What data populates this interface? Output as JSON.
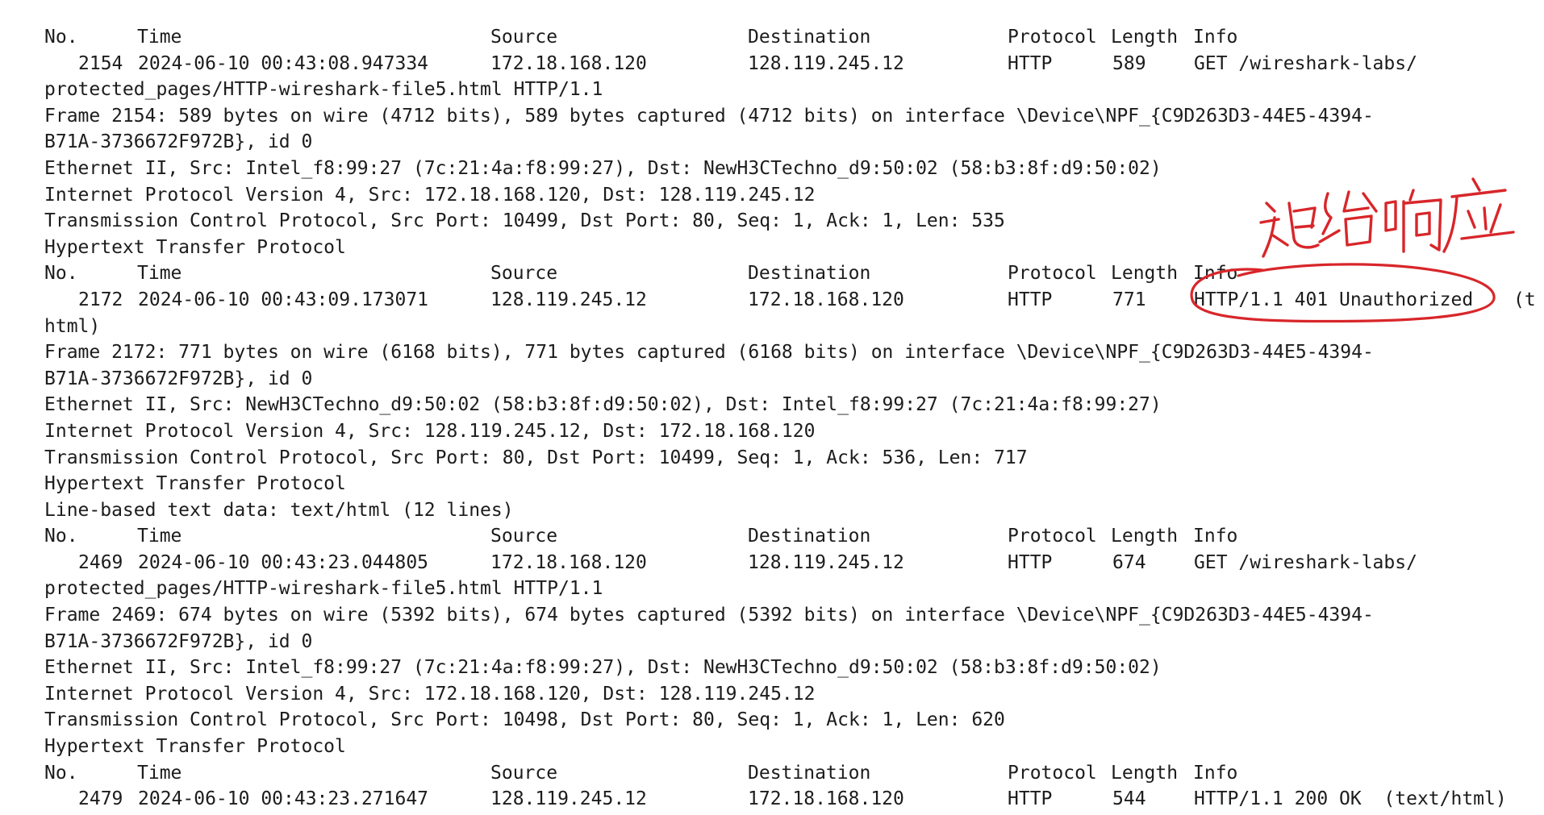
{
  "header": {
    "no": "No.",
    "time": "Time",
    "source": "Source",
    "destination": "Destination",
    "protocol": "Protocol",
    "length": "Length",
    "info": "Info"
  },
  "packets": [
    {
      "summary": {
        "no": "2154",
        "time": "2024-06-10 00:43:08.947334",
        "source": "172.18.168.120",
        "destination": "128.119.245.12",
        "protocol": "HTTP",
        "length": "589",
        "info": "GET /wireshark-labs/",
        "trail": ""
      },
      "details": [
        "protected_pages/HTTP-wireshark-file5.html HTTP/1.1",
        "Frame 2154: 589 bytes on wire (4712 bits), 589 bytes captured (4712 bits) on interface \\Device\\NPF_{C9D263D3-44E5-4394-",
        "B71A-3736672F972B}, id 0",
        "Ethernet II, Src: Intel_f8:99:27 (7c:21:4a:f8:99:27), Dst: NewH3CTechno_d9:50:02 (58:b3:8f:d9:50:02)",
        "Internet Protocol Version 4, Src: 172.18.168.120, Dst: 128.119.245.12",
        "Transmission Control Protocol, Src Port: 10499, Dst Port: 80, Seq: 1, Ack: 1, Len: 535",
        "Hypertext Transfer Protocol"
      ]
    },
    {
      "summary": {
        "no": "2172",
        "time": "2024-06-10 00:43:09.173071",
        "source": "128.119.245.12",
        "destination": "172.18.168.120",
        "protocol": "HTTP",
        "length": "771",
        "info": "HTTP/1.1 401 Unauthorized",
        "trail": "(t"
      },
      "details": [
        "html)",
        "Frame 2172: 771 bytes on wire (6168 bits), 771 bytes captured (6168 bits) on interface \\Device\\NPF_{C9D263D3-44E5-4394-",
        "B71A-3736672F972B}, id 0",
        "Ethernet II, Src: NewH3CTechno_d9:50:02 (58:b3:8f:d9:50:02), Dst: Intel_f8:99:27 (7c:21:4a:f8:99:27)",
        "Internet Protocol Version 4, Src: 128.119.245.12, Dst: 172.18.168.120",
        "Transmission Control Protocol, Src Port: 80, Dst Port: 10499, Seq: 1, Ack: 536, Len: 717",
        "Hypertext Transfer Protocol",
        "Line-based text data: text/html (12 lines)"
      ]
    },
    {
      "summary": {
        "no": "2469",
        "time": "2024-06-10 00:43:23.044805",
        "source": "172.18.168.120",
        "destination": "128.119.245.12",
        "protocol": "HTTP",
        "length": "674",
        "info": "GET /wireshark-labs/",
        "trail": ""
      },
      "details": [
        "protected_pages/HTTP-wireshark-file5.html HTTP/1.1",
        "Frame 2469: 674 bytes on wire (5392 bits), 674 bytes captured (5392 bits) on interface \\Device\\NPF_{C9D263D3-44E5-4394-",
        "B71A-3736672F972B}, id 0",
        "Ethernet II, Src: Intel_f8:99:27 (7c:21:4a:f8:99:27), Dst: NewH3CTechno_d9:50:02 (58:b3:8f:d9:50:02)",
        "Internet Protocol Version 4, Src: 172.18.168.120, Dst: 128.119.245.12",
        "Transmission Control Protocol, Src Port: 10498, Dst Port: 80, Seq: 1, Ack: 1, Len: 620",
        "Hypertext Transfer Protocol"
      ]
    },
    {
      "summary": {
        "no": "2479",
        "time": "2024-06-10 00:43:23.271647",
        "source": "128.119.245.12",
        "destination": "172.18.168.120",
        "protocol": "HTTP",
        "length": "544",
        "info": "HTTP/1.1 200 OK  (text/html)",
        "trail": ""
      },
      "details": []
    }
  ],
  "annotation": {
    "handwritten_text": "拒绝响应",
    "color": "#d8262a",
    "target_packet": "2172"
  },
  "colors": {
    "text": "#1c1c1c",
    "background": "#ffffff",
    "annotation_ink": "#d8262a"
  }
}
